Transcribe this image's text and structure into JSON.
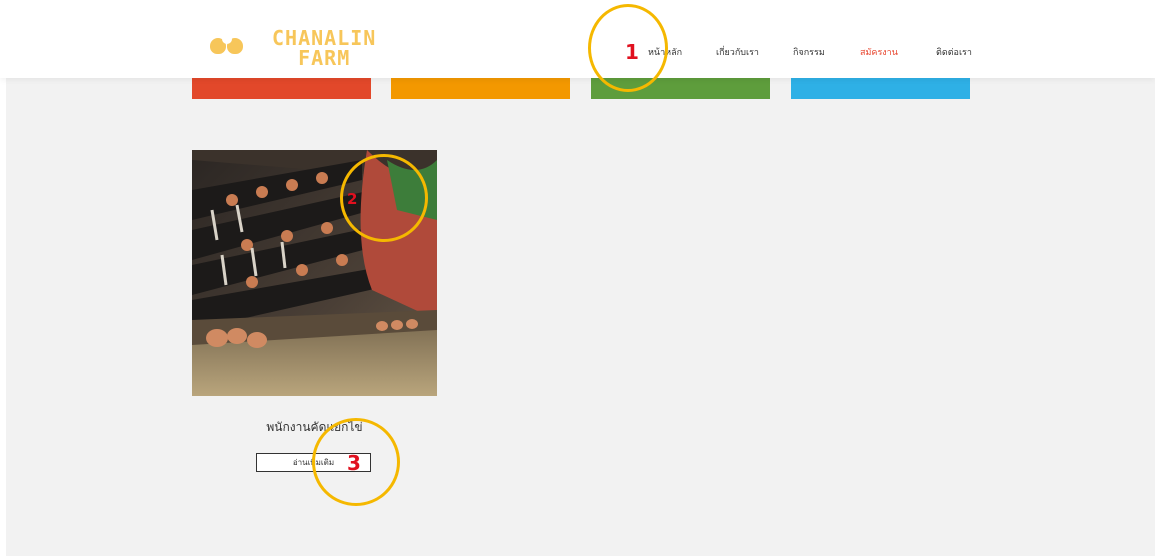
{
  "logo": {
    "line1": "CHANALIN",
    "line2": "FARM"
  },
  "nav": {
    "items": [
      {
        "label": "หน้าหลัก"
      },
      {
        "label": "เกี่ยวกับเรา"
      },
      {
        "label": "กิจกรรม"
      },
      {
        "label": "สมัครงาน"
      },
      {
        "label": "ติดต่อเรา"
      }
    ],
    "active_color": "#e7422a"
  },
  "category_bars": [
    {
      "color": "#e2482a"
    },
    {
      "color": "#f39800"
    },
    {
      "color": "#5e9d3c"
    },
    {
      "color": "#2eb0e6"
    }
  ],
  "card": {
    "title": "พนักงานคัดแยกไข่",
    "button_label": "อ่านเพิ่มเติม"
  },
  "annotations": [
    {
      "number": "1"
    },
    {
      "number": "2"
    },
    {
      "number": "3"
    }
  ],
  "colors": {
    "logo": "#f7c65a",
    "marker_ring": "#f5b800",
    "marker_number": "#e0101f"
  }
}
